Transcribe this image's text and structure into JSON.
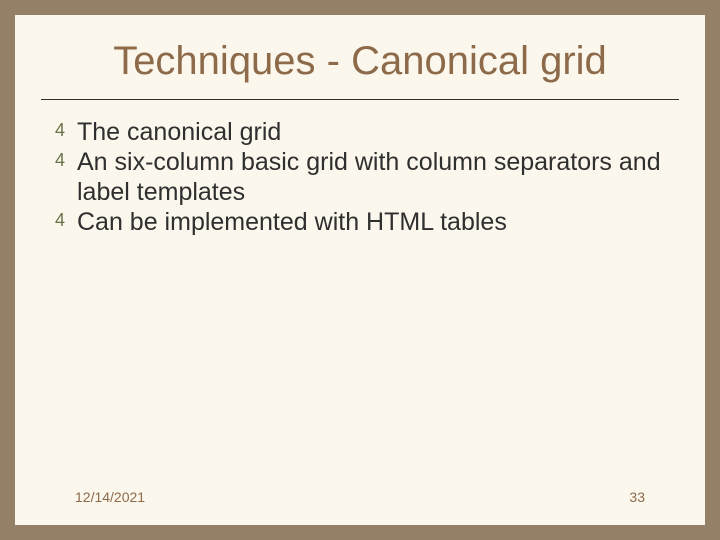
{
  "slide": {
    "title": "Techniques - Canonical grid",
    "bullets": [
      "The canonical grid",
      "An six-column basic grid with column separators and label templates",
      "Can be implemented with HTML tables"
    ],
    "footer": {
      "date": "12/14/2021",
      "page": "33"
    },
    "bullet_glyph": "4"
  }
}
